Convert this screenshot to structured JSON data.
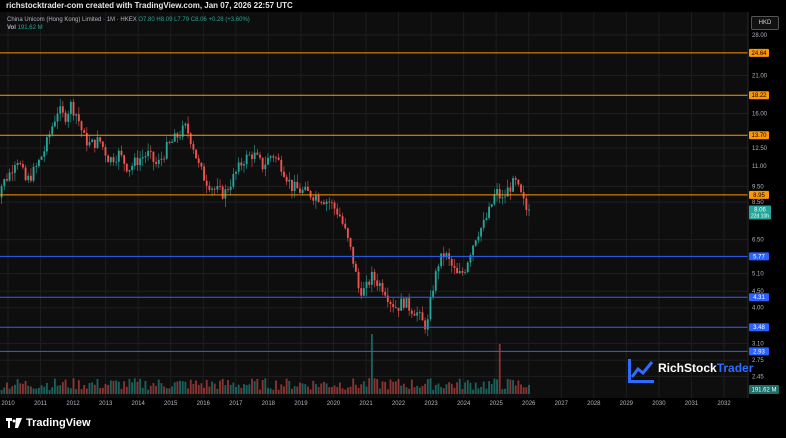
{
  "header": {
    "credit": "richstocktrader-com created with TradingView.com, Jan 07, 2026 22:57 UTC"
  },
  "legend": {
    "symbol": "China Unicom (Hong Kong) Limited · 1M · HKEX",
    "ohlc": "O7.80 H8.09 L7.79 C8.06 +0.28 (+3.60%)",
    "vol_label": "Vol",
    "vol_value": "191.62 M"
  },
  "currency": "HKD",
  "footer": {
    "brand": "TradingView"
  },
  "watermark": {
    "brand_part1": "RichStock",
    "brand_part2": "Trader"
  },
  "chart_data": {
    "type": "candlestick",
    "price_axis": {
      "scale": "log",
      "ylim": [
        2.1,
        33.0
      ],
      "ticks": [
        28.0,
        24.64,
        21.0,
        18.22,
        16.0,
        13.7,
        12.5,
        11.0,
        9.5,
        8.95,
        8.5,
        8.06,
        6.5,
        5.77,
        5.1,
        4.5,
        4.31,
        4.0,
        3.48,
        3.1,
        2.93,
        2.75,
        2.45
      ],
      "tick_labels": [
        "28.00",
        "21.00",
        "16.00",
        "12.50",
        "11.00",
        "9.50",
        "8.50",
        "6.50",
        "5.10",
        "4.50",
        "4.00",
        "3.10",
        "2.75",
        "2.45"
      ]
    },
    "x_axis": {
      "labels": [
        "2010",
        "2011",
        "2012",
        "2013",
        "2014",
        "2015",
        "2016",
        "2017",
        "2018",
        "2019",
        "2020",
        "2021",
        "2022",
        "2023",
        "2024",
        "2025",
        "2026",
        "2027",
        "2028",
        "2029",
        "2030",
        "2031",
        "2032"
      ],
      "range_years": [
        2009.2,
        2032.9
      ]
    },
    "resistance_levels": [
      {
        "value": 24.64,
        "label": "24.64",
        "color": "#ff9800"
      },
      {
        "value": 18.22,
        "label": "18.22",
        "color": "#ff9800"
      },
      {
        "value": 13.7,
        "label": "13.70",
        "color": "#ff9800"
      },
      {
        "value": 8.95,
        "label": "8.95",
        "color": "#ff9800"
      }
    ],
    "support_levels": [
      {
        "value": 5.77,
        "label": "5.77",
        "color": "#2962ff"
      },
      {
        "value": 4.31,
        "label": "4.31",
        "color": "#2962ff"
      },
      {
        "value": 3.48,
        "label": "3.48",
        "color": "#2962ff"
      },
      {
        "value": 2.93,
        "label": "2.93",
        "color": "#2962ff"
      }
    ],
    "last_price": {
      "value": 8.06,
      "label": "8.06",
      "countdown": "22d 10h",
      "color": "#26a69a"
    },
    "volume_label": "191.62 M",
    "colors": {
      "up": "#26a69a",
      "down": "#ef5350",
      "grid": "#1e1e1e"
    },
    "price_path": [
      [
        2009.2,
        7.5
      ],
      [
        2009.5,
        9.5
      ],
      [
        2009.8,
        10.5
      ],
      [
        2010.0,
        11.8
      ],
      [
        2010.3,
        9.8
      ],
      [
        2010.6,
        10.8
      ],
      [
        2010.9,
        12.5
      ],
      [
        2011.1,
        14.5
      ],
      [
        2011.3,
        16.5
      ],
      [
        2011.5,
        15.5
      ],
      [
        2011.7,
        17.0
      ],
      [
        2011.9,
        15.8
      ],
      [
        2012.1,
        13.5
      ],
      [
        2012.3,
        12.8
      ],
      [
        2012.6,
        13.2
      ],
      [
        2012.9,
        11.5
      ],
      [
        2013.2,
        12.0
      ],
      [
        2013.5,
        10.8
      ],
      [
        2013.8,
        11.5
      ],
      [
        2014.1,
        12.0
      ],
      [
        2014.4,
        11.0
      ],
      [
        2014.7,
        12.5
      ],
      [
        2015.0,
        13.5
      ],
      [
        2015.3,
        14.5
      ],
      [
        2015.5,
        13.0
      ],
      [
        2015.7,
        11.0
      ],
      [
        2015.9,
        10.0
      ],
      [
        2016.2,
        9.3
      ],
      [
        2016.5,
        9.0
      ],
      [
        2016.8,
        10.2
      ],
      [
        2017.1,
        11.5
      ],
      [
        2017.4,
        12.0
      ],
      [
        2017.7,
        11.0
      ],
      [
        2018.0,
        12.0
      ],
      [
        2018.3,
        11.0
      ],
      [
        2018.6,
        9.5
      ],
      [
        2018.9,
        9.2
      ],
      [
        2019.2,
        9.0
      ],
      [
        2019.5,
        8.8
      ],
      [
        2019.8,
        8.5
      ],
      [
        2020.1,
        7.8
      ],
      [
        2020.3,
        6.8
      ],
      [
        2020.5,
        5.8
      ],
      [
        2020.7,
        4.6
      ],
      [
        2020.9,
        4.5
      ],
      [
        2021.1,
        5.0
      ],
      [
        2021.3,
        4.8
      ],
      [
        2021.5,
        4.6
      ],
      [
        2021.7,
        4.2
      ],
      [
        2021.9,
        4.0
      ],
      [
        2022.1,
        4.2
      ],
      [
        2022.3,
        4.0
      ],
      [
        2022.5,
        3.9
      ],
      [
        2022.7,
        3.6
      ],
      [
        2022.85,
        3.5
      ],
      [
        2023.0,
        4.5
      ],
      [
        2023.2,
        5.5
      ],
      [
        2023.4,
        5.9
      ],
      [
        2023.6,
        5.4
      ],
      [
        2023.8,
        5.0
      ],
      [
        2024.0,
        5.2
      ],
      [
        2024.2,
        6.0
      ],
      [
        2024.4,
        6.8
      ],
      [
        2024.6,
        7.2
      ],
      [
        2024.8,
        8.0
      ],
      [
        2025.0,
        9.2
      ],
      [
        2025.2,
        8.6
      ],
      [
        2025.4,
        9.4
      ],
      [
        2025.6,
        9.8
      ],
      [
        2025.8,
        8.8
      ],
      [
        2025.95,
        8.06
      ]
    ]
  }
}
